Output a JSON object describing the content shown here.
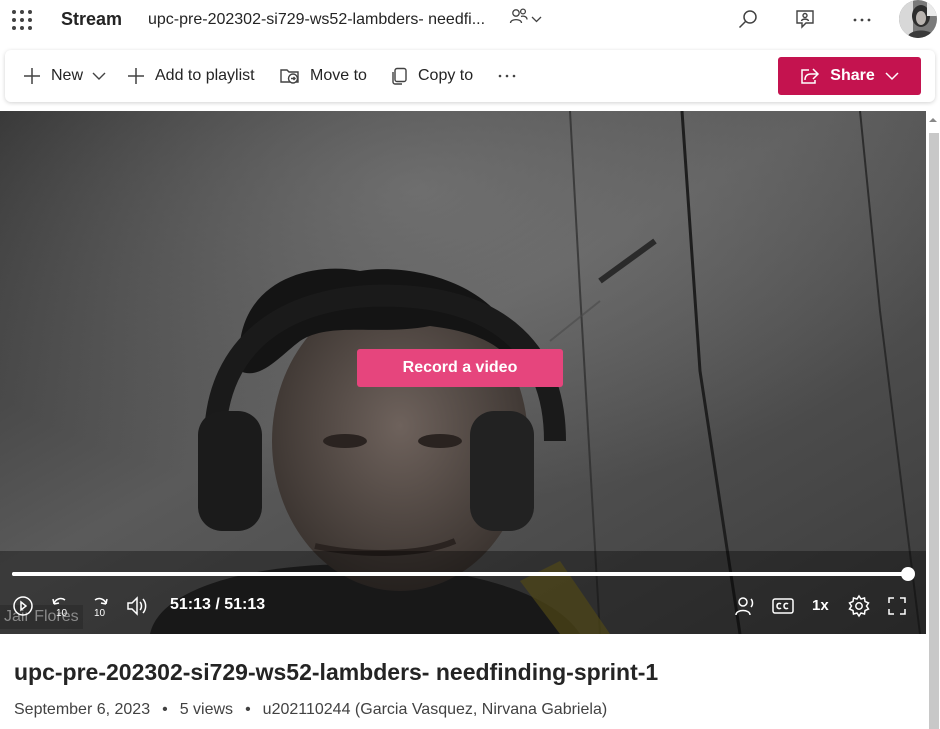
{
  "app": {
    "name": "Stream"
  },
  "document": {
    "title": "upc-pre-202302-si729-ws52-lambders- needfi..."
  },
  "toolbar": {
    "new_label": "New",
    "add_to_playlist_label": "Add to playlist",
    "move_to_label": "Move to",
    "copy_to_label": "Copy to",
    "share_label": "Share"
  },
  "player": {
    "overlay_button_label": "Record a video",
    "time_display": "51:13 / 51:13",
    "progress": 1.0,
    "speed_label": "1x",
    "skip_back_seconds": "10",
    "skip_forward_seconds": "10",
    "speaker_name_tag": "Jair Flores"
  },
  "video_info": {
    "title": "upc-pre-202302-si729-ws52-lambders- needfinding-sprint-1",
    "date": "September 6, 2023",
    "views": "5 views",
    "owner": "u202110244 (Garcia Vasquez, Nirvana Gabriela)"
  },
  "colors": {
    "share_button": "#c4134f",
    "record_button": "#e6457d",
    "text_primary": "#242424"
  },
  "icons": [
    "waffle-icon",
    "people-icon",
    "chevron-down-icon",
    "search-icon",
    "feedback-icon",
    "more-icon",
    "plus-icon",
    "folder-move-icon",
    "copy-icon",
    "share-icon",
    "replay-icon",
    "skip-back-icon",
    "skip-forward-icon",
    "volume-icon",
    "noise-suppression-icon",
    "captions-icon",
    "settings-icon",
    "fullscreen-icon"
  ]
}
